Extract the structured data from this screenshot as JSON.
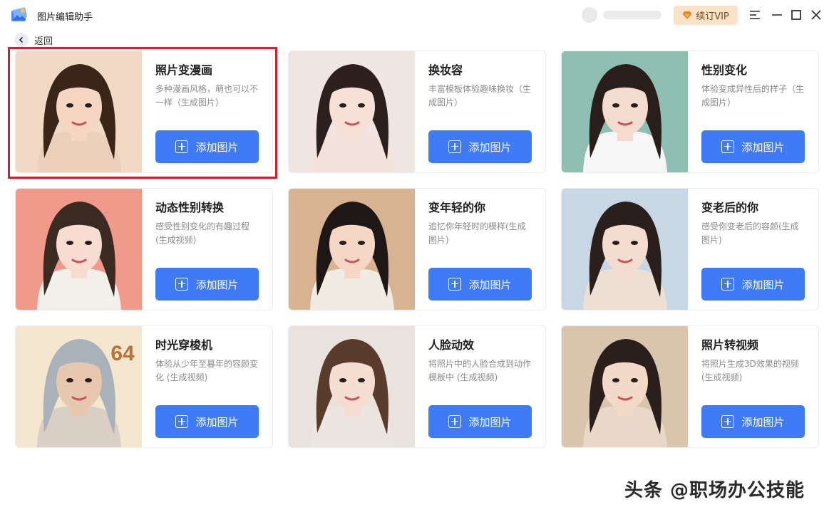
{
  "app": {
    "title": "图片编辑助手"
  },
  "header": {
    "vip_label": "续订VIP",
    "back_label": "返回",
    "user_name": ""
  },
  "cards": [
    {
      "title": "照片变漫画",
      "desc": "多种漫画风格，萌也可以不一样（生成图片）",
      "button": "添加图片",
      "bg": "#f1d9c6",
      "hair": "#3b2418",
      "skin": "#f5d6c3",
      "cloth": "#ecd0bb"
    },
    {
      "title": "换妆容",
      "desc": "丰富模板体验趣味换妆（生成图片）",
      "button": "添加图片",
      "bg": "#f1e5e3",
      "hair": "#2c1f1c",
      "skin": "#f7e0d6",
      "cloth": "#f3e3dc"
    },
    {
      "title": "性别变化",
      "desc": "体验变成异性后的样子（生成图片）",
      "button": "添加图片",
      "bg": "#8fbfb2",
      "hair": "#2a1e1a",
      "skin": "#f3dccd",
      "cloth": "#f6f6f6"
    },
    {
      "title": "动态性别转换",
      "desc": "感受性别变化的有趣过程(生成视频)",
      "button": "添加图片",
      "bg": "#f09a8c",
      "hair": "#3a2a22",
      "skin": "#f7dccf",
      "cloth": "#f3efea"
    },
    {
      "title": "变年轻的你",
      "desc": "追忆你年轻时的模样(生成图片)",
      "button": "添加图片",
      "bg": "#d8b392",
      "hair": "#1e1715",
      "skin": "#f4d7c5",
      "cloth": "#f1ece1"
    },
    {
      "title": "变老后的你",
      "desc": "感受你变老后的容颜(生成图片)",
      "button": "添加图片",
      "bg": "#c9d7e5",
      "hair": "#2a1f1c",
      "skin": "#f4dcd1",
      "cloth": "#eedfd5"
    },
    {
      "title": "时光穿梭机",
      "desc": "体验从少年至暮年的容颜变化 (生成视频)",
      "button": "添加图片",
      "bg": "#f4e6cf",
      "hair": "#a9b2ba",
      "skin": "#e7c7ad",
      "cloth": "#d9cfc4",
      "badge": "64"
    },
    {
      "title": "人脸动效",
      "desc": "将照片中的人脸合成到动作模板中 (生成视频)",
      "button": "添加图片",
      "bg": "#eae2dc",
      "hair": "#5a3c2c",
      "skin": "#f5ddd1",
      "cloth": "#ede6e0"
    },
    {
      "title": "照片转视频",
      "desc": "将照片生成3D效果的视频 (生成视频)",
      "button": "添加图片",
      "bg": "#d9c4ad",
      "hair": "#2b1f1b",
      "skin": "#f3d9c7",
      "cloth": "#e9d8c8"
    }
  ],
  "watermark": "头条 @职场办公技能",
  "colors": {
    "accent": "#3f7bf6",
    "highlight": "#c8242c",
    "vip_bg": "#fbe3c9"
  }
}
